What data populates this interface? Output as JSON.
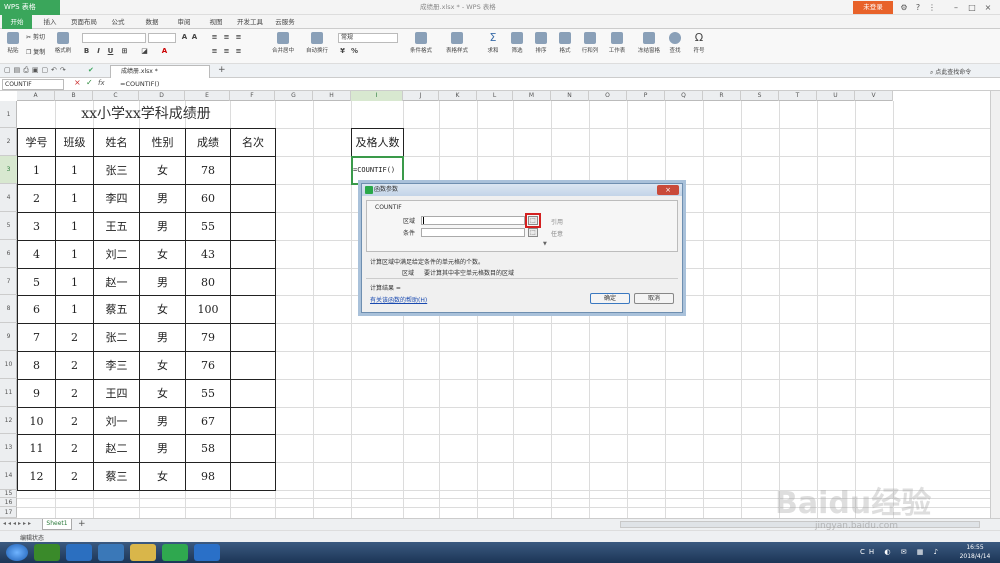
{
  "app": {
    "badge": "WPS 表格",
    "doc_title": "成绩册.xlsx * - WPS 表格",
    "login": "未登录",
    "login_color": "#e8622a",
    "accent": "#3aa65b"
  },
  "menu": [
    "开始",
    "插入",
    "页面布局",
    "公式",
    "数据",
    "审阅",
    "视图",
    "开发工具",
    "云服务"
  ],
  "ribbon": {
    "cut": "剪切",
    "paste": "粘贴",
    "copy": "复制",
    "format_painter": "格式刷",
    "merge": "合并居中",
    "wrap": "自动换行",
    "number_format": "常规",
    "cond_format": "条件格式",
    "table_style": "表格样式",
    "sum": "求和",
    "filter": "筛选",
    "sort": "排序",
    "format": "格式",
    "rowcol": "行和列",
    "worksheet": "工作表",
    "freeze": "冻结窗格",
    "find": "查找",
    "symbol": "符号"
  },
  "doc_tab": "成绩册.xlsx *",
  "formula_bar": {
    "name_box": "COUNTIF",
    "formula": "=COUNTIF()",
    "search_label": "点此查找命令"
  },
  "columns": [
    "A",
    "B",
    "C",
    "D",
    "E",
    "F",
    "G",
    "H",
    "I",
    "J",
    "K",
    "L",
    "M",
    "N",
    "O",
    "P",
    "Q",
    "R",
    "S",
    "T",
    "U",
    "V"
  ],
  "rows": [
    "1",
    "2",
    "3",
    "4",
    "5",
    "6",
    "7",
    "8",
    "9",
    "10",
    "11",
    "12",
    "13",
    "14",
    "15",
    "16",
    "17"
  ],
  "table": {
    "title": "xx小学xx学科成绩册",
    "headers": [
      "学号",
      "班级",
      "姓名",
      "性别",
      "成绩",
      "名次"
    ],
    "data": [
      [
        "1",
        "1",
        "张三",
        "女",
        "78",
        ""
      ],
      [
        "2",
        "1",
        "李四",
        "男",
        "60",
        ""
      ],
      [
        "3",
        "1",
        "王五",
        "男",
        "55",
        ""
      ],
      [
        "4",
        "1",
        "刘二",
        "女",
        "43",
        ""
      ],
      [
        "5",
        "1",
        "赵一",
        "男",
        "80",
        ""
      ],
      [
        "6",
        "1",
        "蔡五",
        "女",
        "100",
        ""
      ],
      [
        "7",
        "2",
        "张二",
        "男",
        "79",
        ""
      ],
      [
        "8",
        "2",
        "李三",
        "女",
        "76",
        ""
      ],
      [
        "9",
        "2",
        "王四",
        "女",
        "55",
        ""
      ],
      [
        "10",
        "2",
        "刘一",
        "男",
        "67",
        ""
      ],
      [
        "11",
        "2",
        "赵二",
        "男",
        "58",
        ""
      ],
      [
        "12",
        "2",
        "蔡三",
        "女",
        "98",
        ""
      ]
    ],
    "i2": "及格人数",
    "i3": "=COUNTIF()"
  },
  "dialog": {
    "title": "函数参数",
    "func": "COUNTIF",
    "arg1_label": "区域",
    "arg1_hint": "引用",
    "arg2_label": "条件",
    "arg2_hint": "任意",
    "desc": "计算区域中满足给定条件的单元格的个数。",
    "arg_desc_label": "区域",
    "arg_desc": "要计算其中非空单元格数目的区域",
    "result_label": "计算结果 =",
    "help": "有关该函数的帮助(H)",
    "ok": "确定",
    "cancel": "取消"
  },
  "sheet": {
    "tab": "Sheet1",
    "status": "编辑状态"
  },
  "taskbar": {
    "time": "16:55",
    "date": "2018/4/14"
  },
  "watermark": {
    "main": "Baidu经验",
    "sub": "jingyan.baidu.com"
  }
}
